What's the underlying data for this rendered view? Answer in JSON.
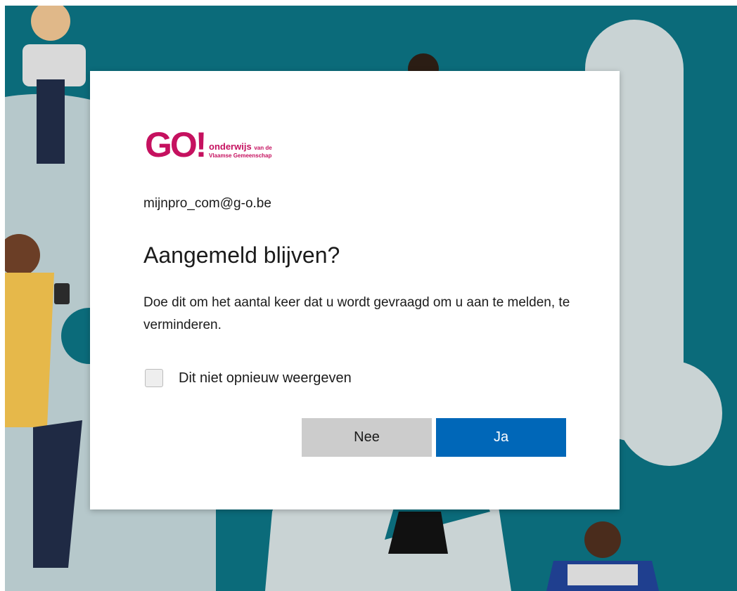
{
  "logo": {
    "mark": "GO!",
    "line1_main": "onderwijs",
    "line1_small": "van de",
    "line2": "Vlaamse Gemeenschap"
  },
  "account": "mijnpro_com@g-o.be",
  "dialog": {
    "title": "Aangemeld blijven?",
    "description": "Doe dit om het aantal keer dat u wordt gevraagd om u aan te melden, te verminderen.",
    "checkbox_label": "Dit niet opnieuw weergeven",
    "checkbox_checked": false,
    "no_label": "Nee",
    "yes_label": "Ja"
  },
  "colors": {
    "brand": "#c5115f",
    "primary_button": "#0067b8",
    "secondary_button": "#cccccc",
    "backdrop": "#0b6b7a"
  }
}
